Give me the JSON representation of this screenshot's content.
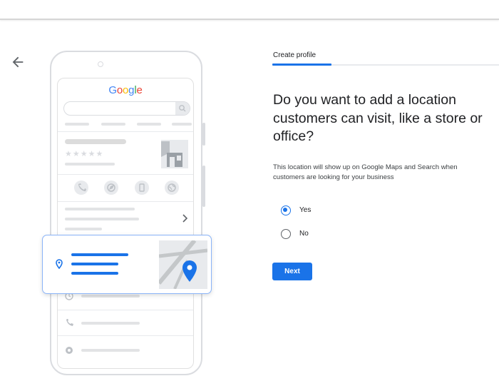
{
  "nav": {
    "back_icon": "arrow-back-icon"
  },
  "illustration": {
    "logo_text": "Google",
    "logo_colors": [
      "#4285F4",
      "#EA4335",
      "#FBBC05",
      "#4285F4",
      "#34A853",
      "#EA4335"
    ],
    "icons": [
      "phone-icon",
      "globe-icon",
      "bookmark-icon",
      "share-icon",
      "chevron-right-icon",
      "location-pin-icon",
      "map-pin-icon",
      "clock-icon",
      "phone-icon",
      "globe-icon"
    ]
  },
  "tabs": {
    "active_label": "Create profile"
  },
  "form": {
    "question": "Do you want to add a location customers can visit, like a store or office?",
    "description": "This location will show up on Google Maps and Search when customers are looking for your business",
    "options": [
      {
        "label": "Yes",
        "selected": true
      },
      {
        "label": "No",
        "selected": false
      }
    ],
    "next_label": "Next"
  },
  "colors": {
    "accent": "#1a73e8",
    "border": "#dadce0"
  }
}
